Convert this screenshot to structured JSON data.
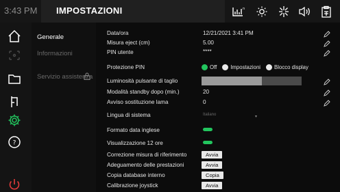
{
  "status": {
    "time": "3:43 PM"
  },
  "header": {
    "title": "IMPOSTAZIONI",
    "badge": "n"
  },
  "top_icons": [
    "chart-icon",
    "brightness-icon",
    "light-icon",
    "volume-icon",
    "clipboard-icon"
  ],
  "rail_icons": [
    "home-icon",
    "connections-icon",
    "folder-icon",
    "cut-icon",
    "settings-icon",
    "help-icon",
    "power-icon"
  ],
  "menu": {
    "items": [
      {
        "label": "Generale"
      },
      {
        "label": "Informazioni"
      },
      {
        "label": "Servizio assistenza"
      }
    ]
  },
  "settings": {
    "datetime": {
      "label": "Data/ora",
      "value": "12/21/2021 3:41 PM"
    },
    "eject": {
      "label": "Misura eject (cm)",
      "value": "5.00"
    },
    "pin": {
      "label": "PIN utente",
      "value": "****"
    },
    "protection": {
      "label": "Protezione PIN",
      "options": [
        "Off",
        "Impostazioni",
        "Blocco display"
      ],
      "selected": "Off"
    },
    "brightness": {
      "label": "Luminosità pulsante di taglio",
      "level_percent": 60
    },
    "standby": {
      "label": "Modalità standby dopo (min.)",
      "value": "20"
    },
    "blade": {
      "label": "Avviso sostituzione lama",
      "value": "0"
    },
    "language": {
      "label": "Lingua di sistema",
      "value": "Italiano"
    },
    "date_format": {
      "label": "Formato data inglese",
      "enabled": true
    },
    "hour12": {
      "label": "Visualizzazione 12 ore",
      "enabled": true
    },
    "ref_correction": {
      "label": "Correzione misura di riferimento",
      "button": "Avvia"
    },
    "performance": {
      "label": "Adeguamento delle prestazioni",
      "button": "Avvia"
    },
    "db_copy": {
      "label": "Copia database interno",
      "button": "Copia"
    },
    "joystick": {
      "label": "Calibrazione joystick",
      "button": "Avvia"
    }
  },
  "colors": {
    "accent": "#22c55e",
    "power": "#e23b3b",
    "settings_active": "#22c55e"
  }
}
